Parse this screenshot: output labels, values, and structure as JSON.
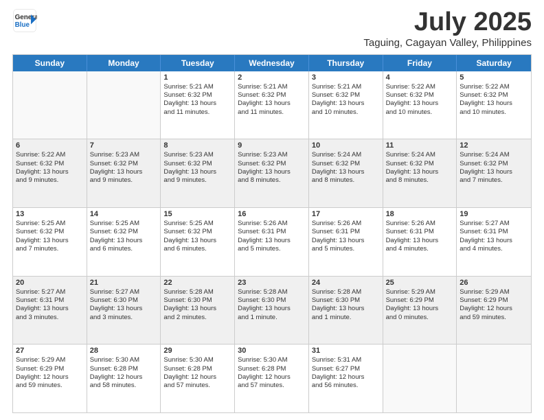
{
  "header": {
    "logo_line1": "General",
    "logo_line2": "Blue",
    "main_title": "July 2025",
    "subtitle": "Taguing, Cagayan Valley, Philippines"
  },
  "weekdays": [
    "Sunday",
    "Monday",
    "Tuesday",
    "Wednesday",
    "Thursday",
    "Friday",
    "Saturday"
  ],
  "rows": [
    [
      {
        "day": "",
        "lines": [],
        "empty": true
      },
      {
        "day": "",
        "lines": [],
        "empty": true
      },
      {
        "day": "1",
        "lines": [
          "Sunrise: 5:21 AM",
          "Sunset: 6:32 PM",
          "Daylight: 13 hours",
          "and 11 minutes."
        ]
      },
      {
        "day": "2",
        "lines": [
          "Sunrise: 5:21 AM",
          "Sunset: 6:32 PM",
          "Daylight: 13 hours",
          "and 11 minutes."
        ]
      },
      {
        "day": "3",
        "lines": [
          "Sunrise: 5:21 AM",
          "Sunset: 6:32 PM",
          "Daylight: 13 hours",
          "and 10 minutes."
        ]
      },
      {
        "day": "4",
        "lines": [
          "Sunrise: 5:22 AM",
          "Sunset: 6:32 PM",
          "Daylight: 13 hours",
          "and 10 minutes."
        ]
      },
      {
        "day": "5",
        "lines": [
          "Sunrise: 5:22 AM",
          "Sunset: 6:32 PM",
          "Daylight: 13 hours",
          "and 10 minutes."
        ]
      }
    ],
    [
      {
        "day": "6",
        "lines": [
          "Sunrise: 5:22 AM",
          "Sunset: 6:32 PM",
          "Daylight: 13 hours",
          "and 9 minutes."
        ],
        "shaded": true
      },
      {
        "day": "7",
        "lines": [
          "Sunrise: 5:23 AM",
          "Sunset: 6:32 PM",
          "Daylight: 13 hours",
          "and 9 minutes."
        ],
        "shaded": true
      },
      {
        "day": "8",
        "lines": [
          "Sunrise: 5:23 AM",
          "Sunset: 6:32 PM",
          "Daylight: 13 hours",
          "and 9 minutes."
        ],
        "shaded": true
      },
      {
        "day": "9",
        "lines": [
          "Sunrise: 5:23 AM",
          "Sunset: 6:32 PM",
          "Daylight: 13 hours",
          "and 8 minutes."
        ],
        "shaded": true
      },
      {
        "day": "10",
        "lines": [
          "Sunrise: 5:24 AM",
          "Sunset: 6:32 PM",
          "Daylight: 13 hours",
          "and 8 minutes."
        ],
        "shaded": true
      },
      {
        "day": "11",
        "lines": [
          "Sunrise: 5:24 AM",
          "Sunset: 6:32 PM",
          "Daylight: 13 hours",
          "and 8 minutes."
        ],
        "shaded": true
      },
      {
        "day": "12",
        "lines": [
          "Sunrise: 5:24 AM",
          "Sunset: 6:32 PM",
          "Daylight: 13 hours",
          "and 7 minutes."
        ],
        "shaded": true
      }
    ],
    [
      {
        "day": "13",
        "lines": [
          "Sunrise: 5:25 AM",
          "Sunset: 6:32 PM",
          "Daylight: 13 hours",
          "and 7 minutes."
        ]
      },
      {
        "day": "14",
        "lines": [
          "Sunrise: 5:25 AM",
          "Sunset: 6:32 PM",
          "Daylight: 13 hours",
          "and 6 minutes."
        ]
      },
      {
        "day": "15",
        "lines": [
          "Sunrise: 5:25 AM",
          "Sunset: 6:32 PM",
          "Daylight: 13 hours",
          "and 6 minutes."
        ]
      },
      {
        "day": "16",
        "lines": [
          "Sunrise: 5:26 AM",
          "Sunset: 6:31 PM",
          "Daylight: 13 hours",
          "and 5 minutes."
        ]
      },
      {
        "day": "17",
        "lines": [
          "Sunrise: 5:26 AM",
          "Sunset: 6:31 PM",
          "Daylight: 13 hours",
          "and 5 minutes."
        ]
      },
      {
        "day": "18",
        "lines": [
          "Sunrise: 5:26 AM",
          "Sunset: 6:31 PM",
          "Daylight: 13 hours",
          "and 4 minutes."
        ]
      },
      {
        "day": "19",
        "lines": [
          "Sunrise: 5:27 AM",
          "Sunset: 6:31 PM",
          "Daylight: 13 hours",
          "and 4 minutes."
        ]
      }
    ],
    [
      {
        "day": "20",
        "lines": [
          "Sunrise: 5:27 AM",
          "Sunset: 6:31 PM",
          "Daylight: 13 hours",
          "and 3 minutes."
        ],
        "shaded": true
      },
      {
        "day": "21",
        "lines": [
          "Sunrise: 5:27 AM",
          "Sunset: 6:30 PM",
          "Daylight: 13 hours",
          "and 3 minutes."
        ],
        "shaded": true
      },
      {
        "day": "22",
        "lines": [
          "Sunrise: 5:28 AM",
          "Sunset: 6:30 PM",
          "Daylight: 13 hours",
          "and 2 minutes."
        ],
        "shaded": true
      },
      {
        "day": "23",
        "lines": [
          "Sunrise: 5:28 AM",
          "Sunset: 6:30 PM",
          "Daylight: 13 hours",
          "and 1 minute."
        ],
        "shaded": true
      },
      {
        "day": "24",
        "lines": [
          "Sunrise: 5:28 AM",
          "Sunset: 6:30 PM",
          "Daylight: 13 hours",
          "and 1 minute."
        ],
        "shaded": true
      },
      {
        "day": "25",
        "lines": [
          "Sunrise: 5:29 AM",
          "Sunset: 6:29 PM",
          "Daylight: 13 hours",
          "and 0 minutes."
        ],
        "shaded": true
      },
      {
        "day": "26",
        "lines": [
          "Sunrise: 5:29 AM",
          "Sunset: 6:29 PM",
          "Daylight: 12 hours",
          "and 59 minutes."
        ],
        "shaded": true
      }
    ],
    [
      {
        "day": "27",
        "lines": [
          "Sunrise: 5:29 AM",
          "Sunset: 6:29 PM",
          "Daylight: 12 hours",
          "and 59 minutes."
        ]
      },
      {
        "day": "28",
        "lines": [
          "Sunrise: 5:30 AM",
          "Sunset: 6:28 PM",
          "Daylight: 12 hours",
          "and 58 minutes."
        ]
      },
      {
        "day": "29",
        "lines": [
          "Sunrise: 5:30 AM",
          "Sunset: 6:28 PM",
          "Daylight: 12 hours",
          "and 57 minutes."
        ]
      },
      {
        "day": "30",
        "lines": [
          "Sunrise: 5:30 AM",
          "Sunset: 6:28 PM",
          "Daylight: 12 hours",
          "and 57 minutes."
        ]
      },
      {
        "day": "31",
        "lines": [
          "Sunrise: 5:31 AM",
          "Sunset: 6:27 PM",
          "Daylight: 12 hours",
          "and 56 minutes."
        ]
      },
      {
        "day": "",
        "lines": [],
        "empty": true
      },
      {
        "day": "",
        "lines": [],
        "empty": true
      }
    ]
  ]
}
